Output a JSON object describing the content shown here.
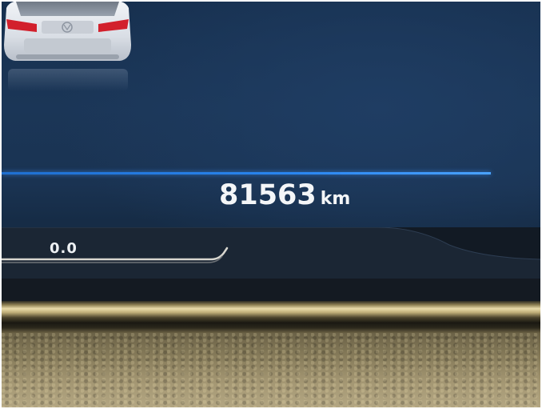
{
  "odometer": {
    "value": "81563",
    "unit": "km"
  },
  "trip": {
    "value": "0.0"
  },
  "icons": {
    "vehicle": "car-rear-icon"
  },
  "colors": {
    "accent_line": "#2a86f0",
    "display_background": "#1a3352",
    "text": "#f4f6f8"
  }
}
